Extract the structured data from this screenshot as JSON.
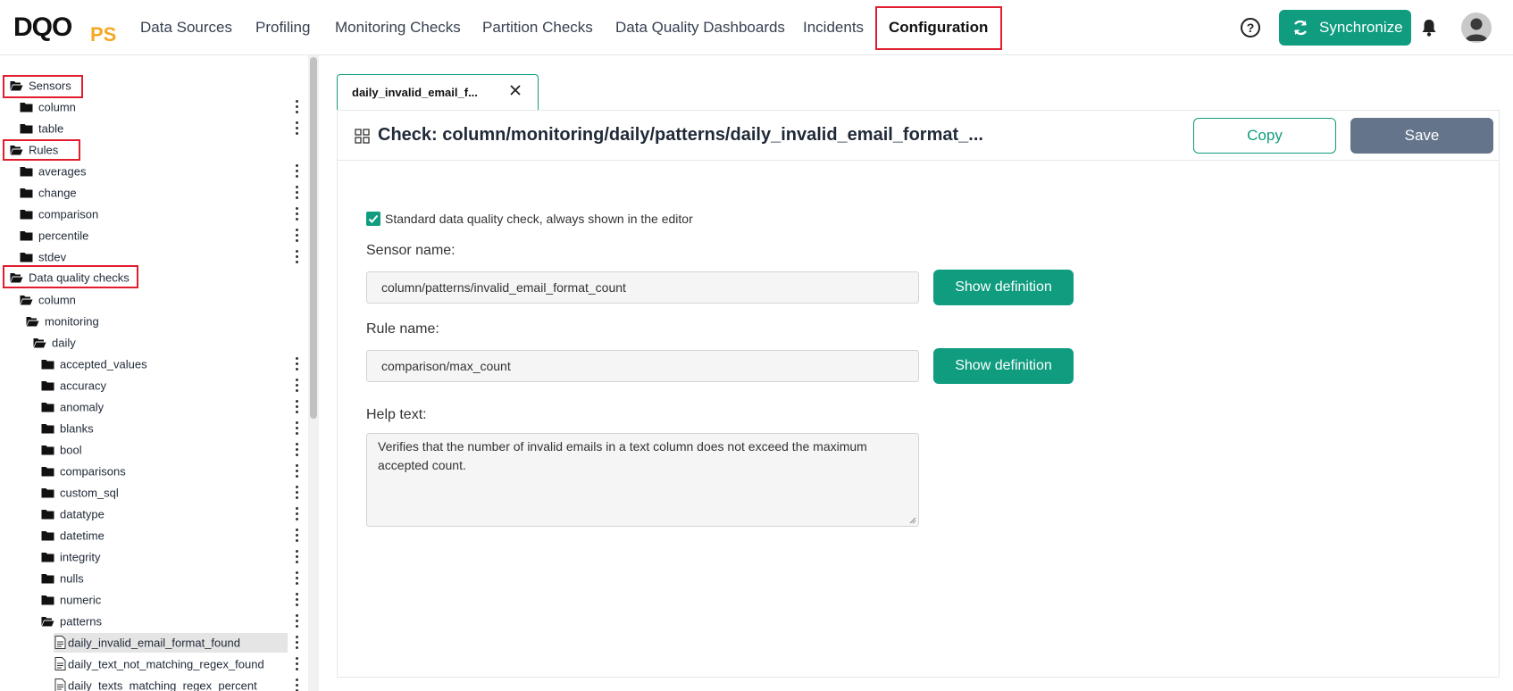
{
  "brand": {
    "logo_main": "DQO",
    "logo_suffix": "PS"
  },
  "nav": {
    "items": [
      "Data Sources",
      "Profiling",
      "Monitoring Checks",
      "Partition Checks",
      "Data Quality Dashboards",
      "Incidents",
      "Configuration"
    ],
    "active": "Configuration"
  },
  "header": {
    "help_glyph": "?",
    "sync_label": "Synchronize"
  },
  "sidebar": {
    "rows": [
      {
        "label": "Sensors",
        "type": "folder-open",
        "indent": 0,
        "kebab": false
      },
      {
        "label": "column",
        "type": "folder",
        "indent": 1,
        "kebab": true
      },
      {
        "label": "table",
        "type": "folder",
        "indent": 1,
        "kebab": true
      },
      {
        "label": "Rules",
        "type": "folder-open",
        "indent": 0,
        "kebab": false
      },
      {
        "label": "averages",
        "type": "folder",
        "indent": 1,
        "kebab": true
      },
      {
        "label": "change",
        "type": "folder",
        "indent": 1,
        "kebab": true
      },
      {
        "label": "comparison",
        "type": "folder",
        "indent": 1,
        "kebab": true
      },
      {
        "label": "percentile",
        "type": "folder",
        "indent": 1,
        "kebab": true
      },
      {
        "label": "stdev",
        "type": "folder",
        "indent": 1,
        "kebab": true
      },
      {
        "label": "Data quality checks",
        "type": "folder-open",
        "indent": 0,
        "kebab": false
      },
      {
        "label": "column",
        "type": "folder-open",
        "indent": 1,
        "kebab": false
      },
      {
        "label": "monitoring",
        "type": "folder-open",
        "indent": 2,
        "kebab": false
      },
      {
        "label": "daily",
        "type": "folder-open",
        "indent": 3,
        "kebab": false
      },
      {
        "label": "accepted_values",
        "type": "folder",
        "indent": 4,
        "kebab": true
      },
      {
        "label": "accuracy",
        "type": "folder",
        "indent": 4,
        "kebab": true
      },
      {
        "label": "anomaly",
        "type": "folder",
        "indent": 4,
        "kebab": true
      },
      {
        "label": "blanks",
        "type": "folder",
        "indent": 4,
        "kebab": true
      },
      {
        "label": "bool",
        "type": "folder",
        "indent": 4,
        "kebab": true
      },
      {
        "label": "comparisons",
        "type": "folder",
        "indent": 4,
        "kebab": true
      },
      {
        "label": "custom_sql",
        "type": "folder",
        "indent": 4,
        "kebab": true
      },
      {
        "label": "datatype",
        "type": "folder",
        "indent": 4,
        "kebab": true
      },
      {
        "label": "datetime",
        "type": "folder",
        "indent": 4,
        "kebab": true
      },
      {
        "label": "integrity",
        "type": "folder",
        "indent": 4,
        "kebab": true
      },
      {
        "label": "nulls",
        "type": "folder",
        "indent": 4,
        "kebab": true
      },
      {
        "label": "numeric",
        "type": "folder",
        "indent": 4,
        "kebab": true
      },
      {
        "label": "patterns",
        "type": "folder-open",
        "indent": 4,
        "kebab": true
      },
      {
        "label": "daily_invalid_email_format_found",
        "type": "doc",
        "indent": 5,
        "kebab": true,
        "selected": true
      },
      {
        "label": "daily_text_not_matching_regex_found",
        "type": "doc",
        "indent": 5,
        "kebab": true
      },
      {
        "label": "daily_texts_matching_regex_percent",
        "type": "doc",
        "indent": 5,
        "kebab": true
      }
    ]
  },
  "main": {
    "tab_label": "daily_invalid_email_f...",
    "title": "Check: column/monitoring/daily/patterns/daily_invalid_email_format_...",
    "copy_label": "Copy",
    "save_label": "Save",
    "standard_check": {
      "checked": true,
      "label": "Standard data quality check, always shown in the editor"
    },
    "sensor_label": "Sensor name:",
    "sensor_value": "column/patterns/invalid_email_format_count",
    "rule_label": "Rule name:",
    "rule_value": "comparison/max_count",
    "show_definition_label": "Show definition",
    "help_label": "Help text:",
    "help_value": "Verifies that the number of invalid emails in a text column does not exceed the maximum accepted count."
  },
  "colors": {
    "accent": "#0f9c7f",
    "save": "#64748b",
    "highlight": "#e11d2e",
    "logo_ps": "#f6a723"
  }
}
